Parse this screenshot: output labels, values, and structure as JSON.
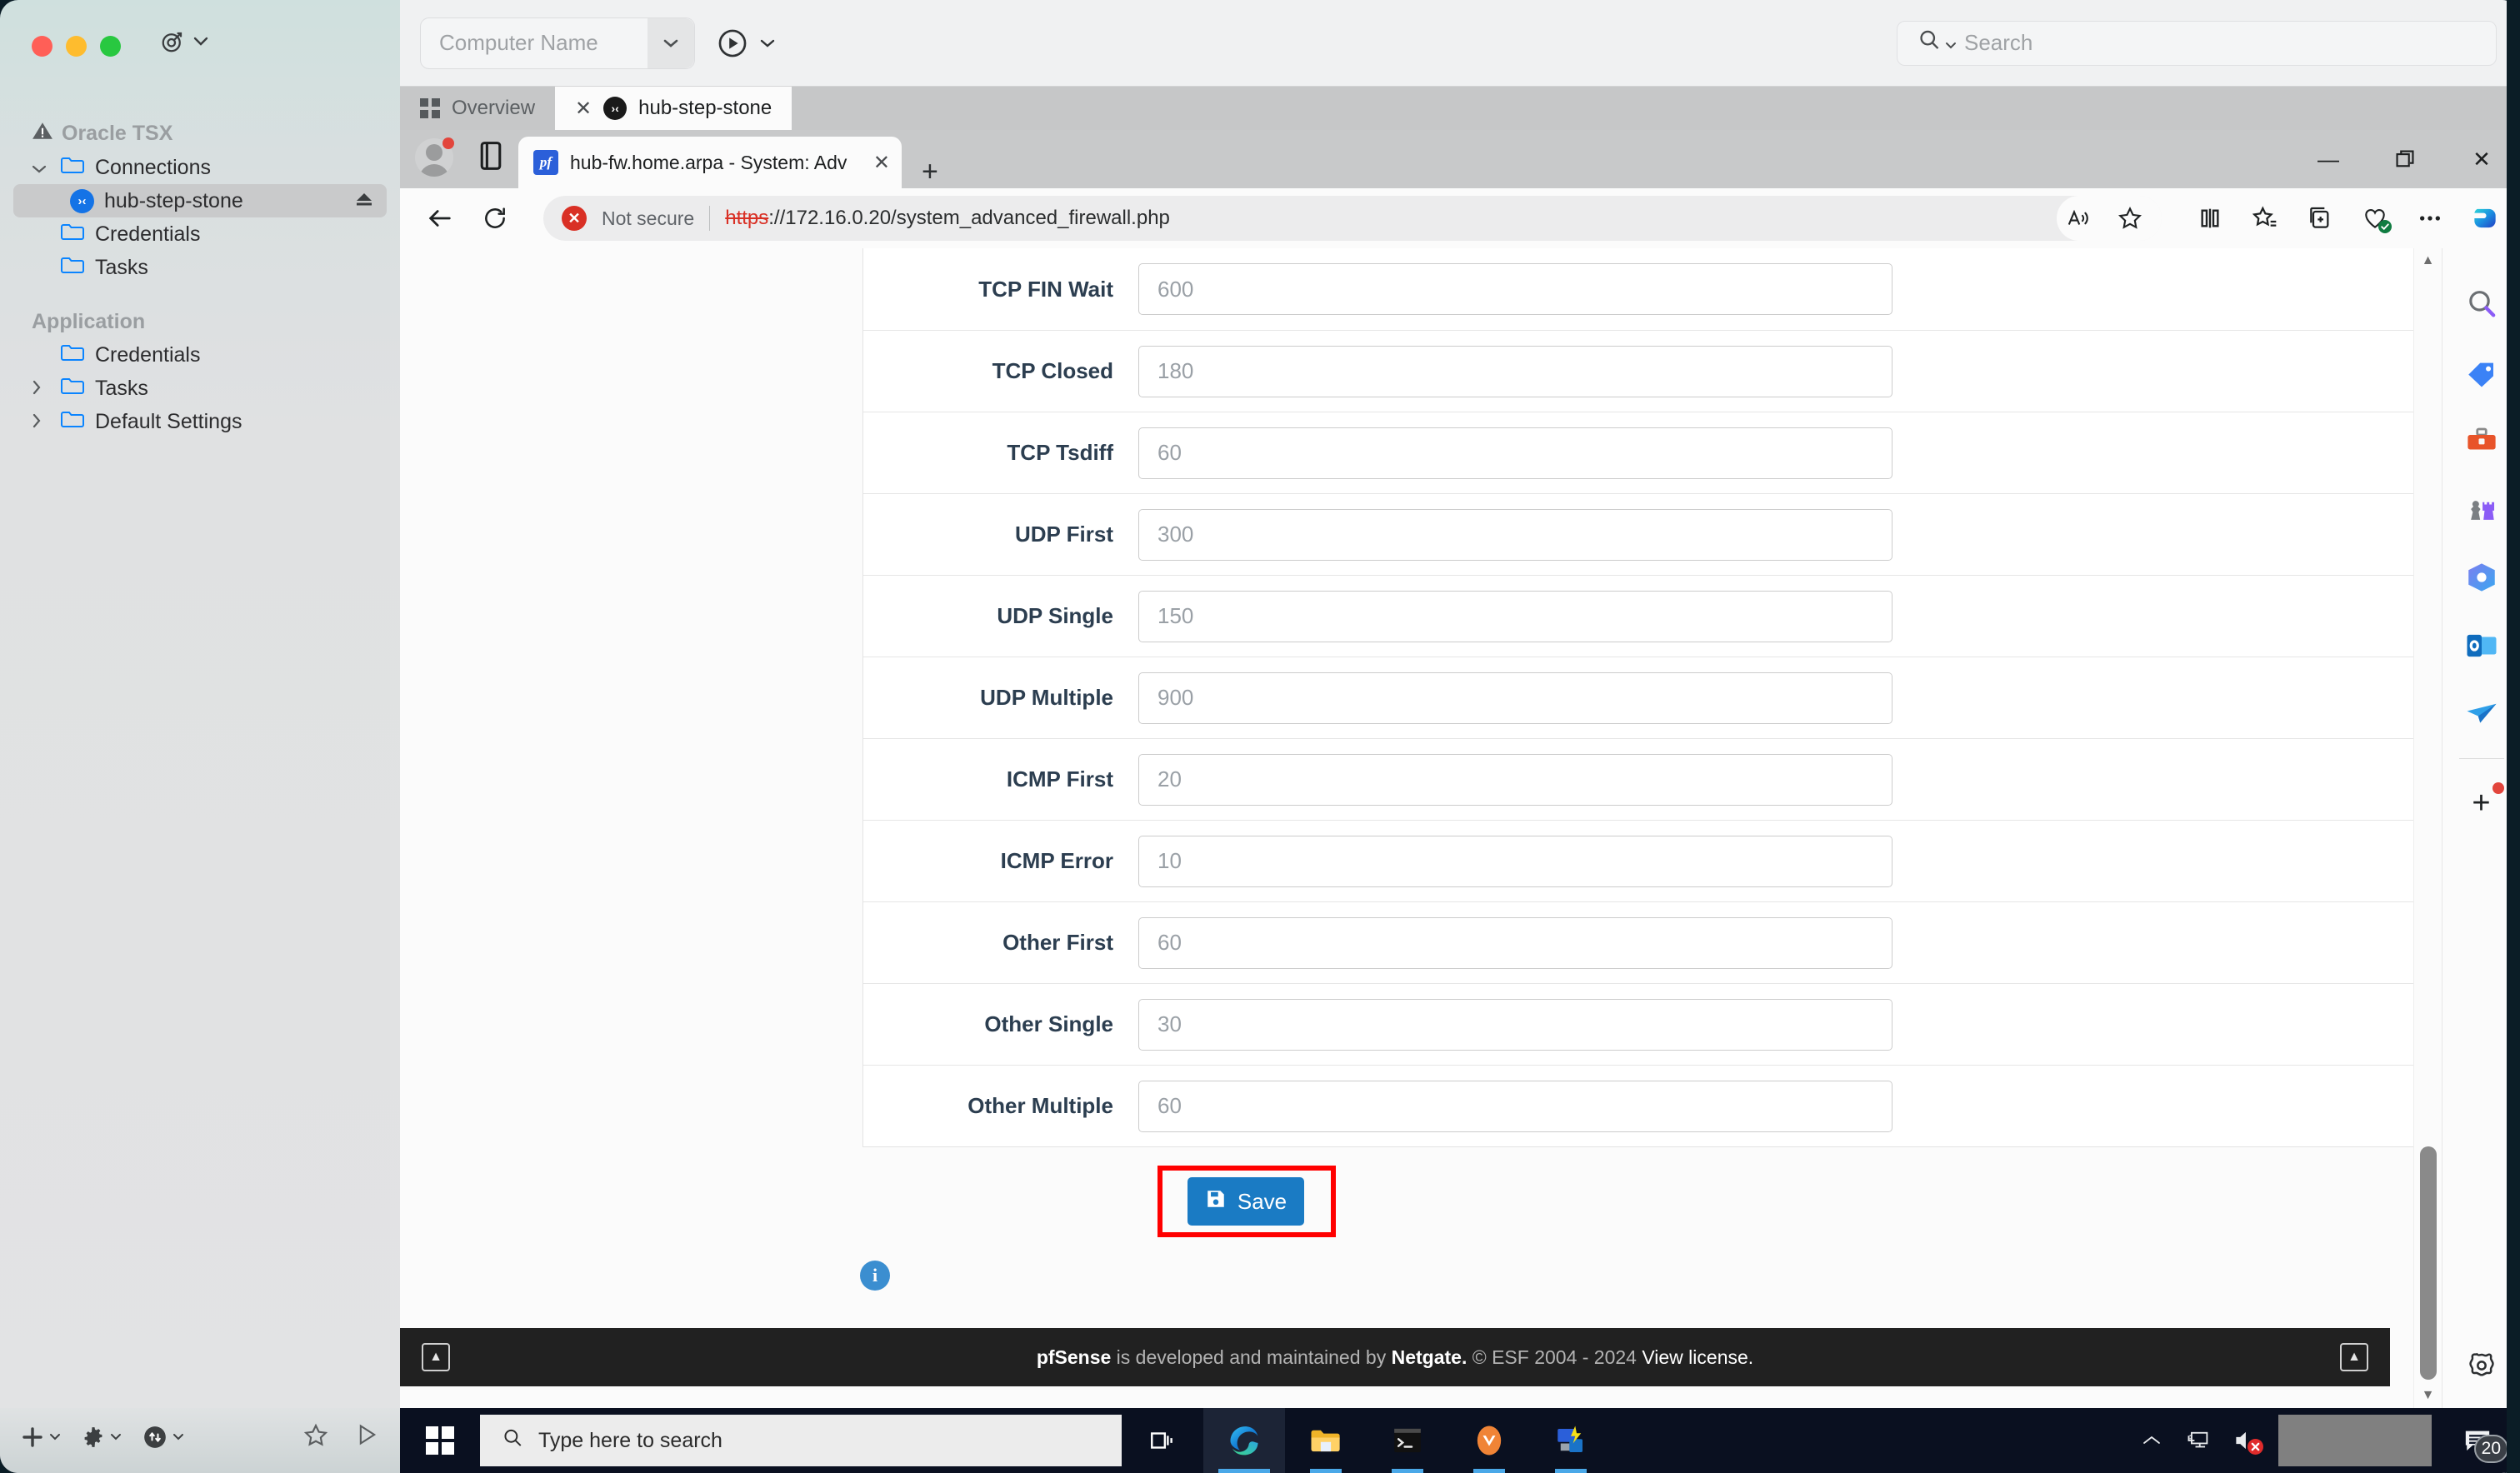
{
  "mac": {
    "window_controls": [
      "close",
      "minimize",
      "zoom"
    ],
    "target_icon": "target-icon",
    "computer_name": {
      "placeholder": "Computer Name"
    },
    "search": {
      "placeholder": "Search"
    },
    "sidebar": {
      "root": {
        "label": "Oracle TSX",
        "icon": "warning-icon"
      },
      "groups": [
        {
          "label": "Connections",
          "items": [
            {
              "label": "hub-step-stone",
              "icon": "xshell-connection-icon",
              "selected": true,
              "trailing": "eject-icon"
            },
            {
              "label": "Credentials",
              "icon": "folder-icon"
            },
            {
              "label": "Tasks",
              "icon": "folder-icon"
            }
          ]
        },
        {
          "label": "Application",
          "items": [
            {
              "label": "Credentials",
              "icon": "folder-icon"
            },
            {
              "label": "Tasks",
              "icon": "folder-icon",
              "expandable": true
            },
            {
              "label": "Default Settings",
              "icon": "folder-icon",
              "expandable": true
            }
          ]
        }
      ],
      "bottom_buttons": [
        "add-icon",
        "settings-gear-icon",
        "sync-icon",
        "favorite-star-icon",
        "run-icon"
      ]
    },
    "tabs": [
      {
        "label": "Overview",
        "icon": "grid-icon",
        "active": false
      },
      {
        "label": "hub-step-stone",
        "icon": "xshell-session-icon",
        "active": true,
        "closable": true
      }
    ]
  },
  "edge": {
    "tab": {
      "title": "hub-fw.home.arpa - System: Adv",
      "favicon": "pfsense-favicon"
    },
    "new_tab_label": "+",
    "window_controls": {
      "minimize": "—",
      "restore": "❐",
      "close": "✕"
    },
    "toolbar": {
      "back": "back-arrow-icon",
      "refresh": "refresh-icon",
      "security_badge": "Not secure",
      "security_icon": "not-secure-icon",
      "url_scheme": "https",
      "url_rest": "://172.16.0.20/system_advanced_firewall.php",
      "read_aloud": "read-aloud-icon",
      "favorite": "favorite-star-icon",
      "split_screen": "split-screen-icon",
      "favorites_hub": "favorites-icon",
      "collections": "collections-icon",
      "browser_essentials": "browser-essentials-icon",
      "settings_more": "more-options-icon",
      "copilot": "copilot-icon"
    },
    "sidebar_items": [
      "search-icon",
      "shopping-tag-icon",
      "tools-icon",
      "games-icon",
      "microsoft365-icon",
      "outlook-icon",
      "send-icon"
    ],
    "sidebar_add": "add-sidebar-app-icon",
    "sidebar_settings": "sidebar-settings-icon"
  },
  "pfsense": {
    "fields": [
      {
        "label": "TCP FIN Wait",
        "value": "600"
      },
      {
        "label": "TCP Closed",
        "value": "180"
      },
      {
        "label": "TCP Tsdiff",
        "value": "60"
      },
      {
        "label": "UDP First",
        "value": "300"
      },
      {
        "label": "UDP Single",
        "value": "150"
      },
      {
        "label": "UDP Multiple",
        "value": "900"
      },
      {
        "label": "ICMP First",
        "value": "20"
      },
      {
        "label": "ICMP Error",
        "value": "10"
      },
      {
        "label": "Other First",
        "value": "60"
      },
      {
        "label": "Other Single",
        "value": "30"
      },
      {
        "label": "Other Multiple",
        "value": "60"
      }
    ],
    "save_label": "Save",
    "save_icon": "floppy-disk-icon",
    "info_icon": "info-icon",
    "highlight_color": "#ff0000",
    "accent_color": "#1a7bc4",
    "footer": {
      "brand": "pfSense",
      "text_1": " is developed and maintained by ",
      "vendor": "Netgate.",
      "text_2": " © ESF 2004 - 2024 ",
      "license_link": "View license."
    }
  },
  "windows": {
    "start": "windows-start-icon",
    "search": {
      "placeholder": "Type here to search",
      "icon": "search-icon"
    },
    "taskview": "task-view-icon",
    "apps": [
      {
        "name": "edge-icon",
        "active": true
      },
      {
        "name": "file-explorer-icon",
        "open": true
      },
      {
        "name": "terminal-icon",
        "open": true
      },
      {
        "name": "app-orange-icon",
        "open": true
      },
      {
        "name": "remote-desktop-icon",
        "open": true
      }
    ],
    "tray": {
      "chevron": "show-hidden-icons-icon",
      "network": "network-icon",
      "volume": "volume-muted-icon",
      "notifications": "notifications-icon",
      "badge_count": "20"
    }
  }
}
